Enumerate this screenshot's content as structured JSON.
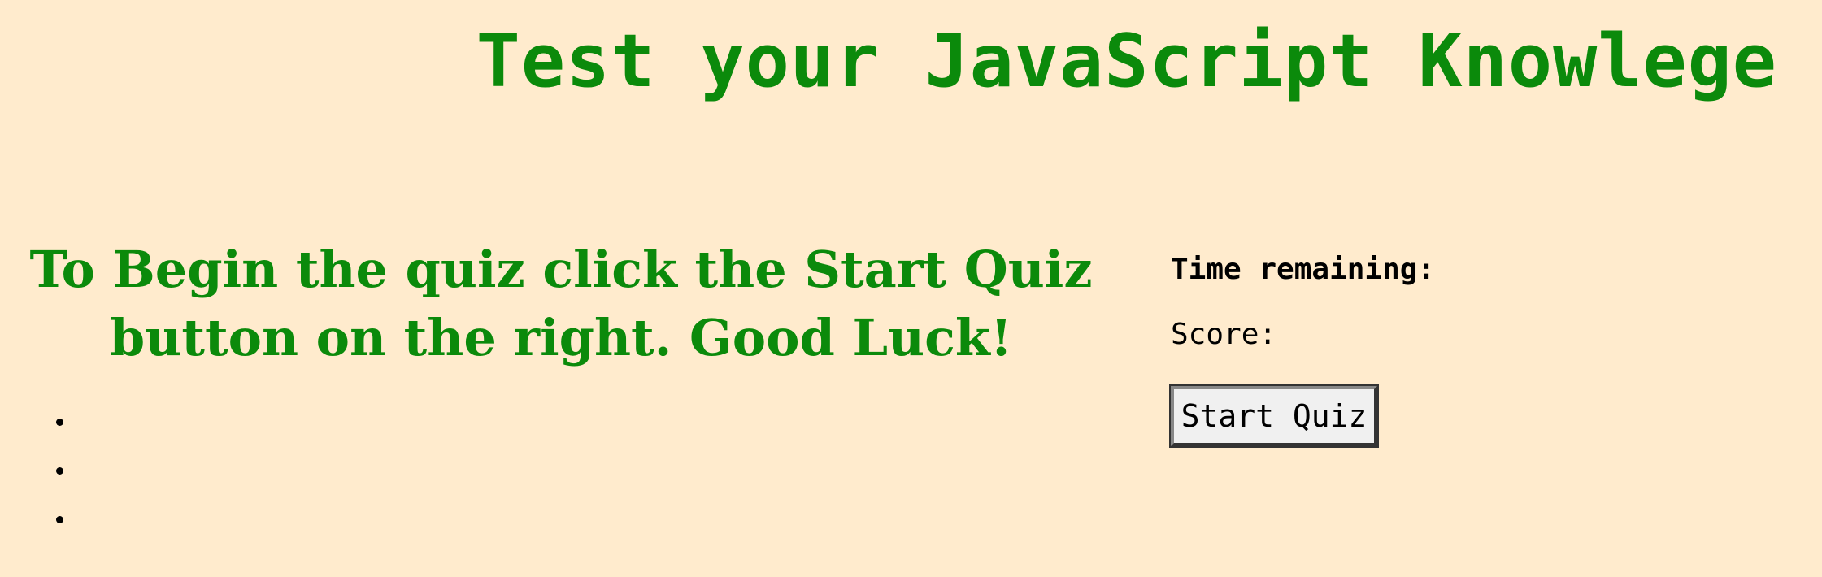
{
  "header": {
    "title": "Test your JavaScript Knowlege"
  },
  "main": {
    "instructions": "To Begin the quiz click the Start Quiz button on the right. Good Luck!",
    "answer_items": [
      "",
      "",
      ""
    ]
  },
  "sidebar": {
    "timer_label": "Time remaining:",
    "score_label": "Score:",
    "start_button_label": "Start Quiz"
  },
  "colors": {
    "background": "#FFEBCD",
    "heading_green": "#0b8a0b"
  }
}
